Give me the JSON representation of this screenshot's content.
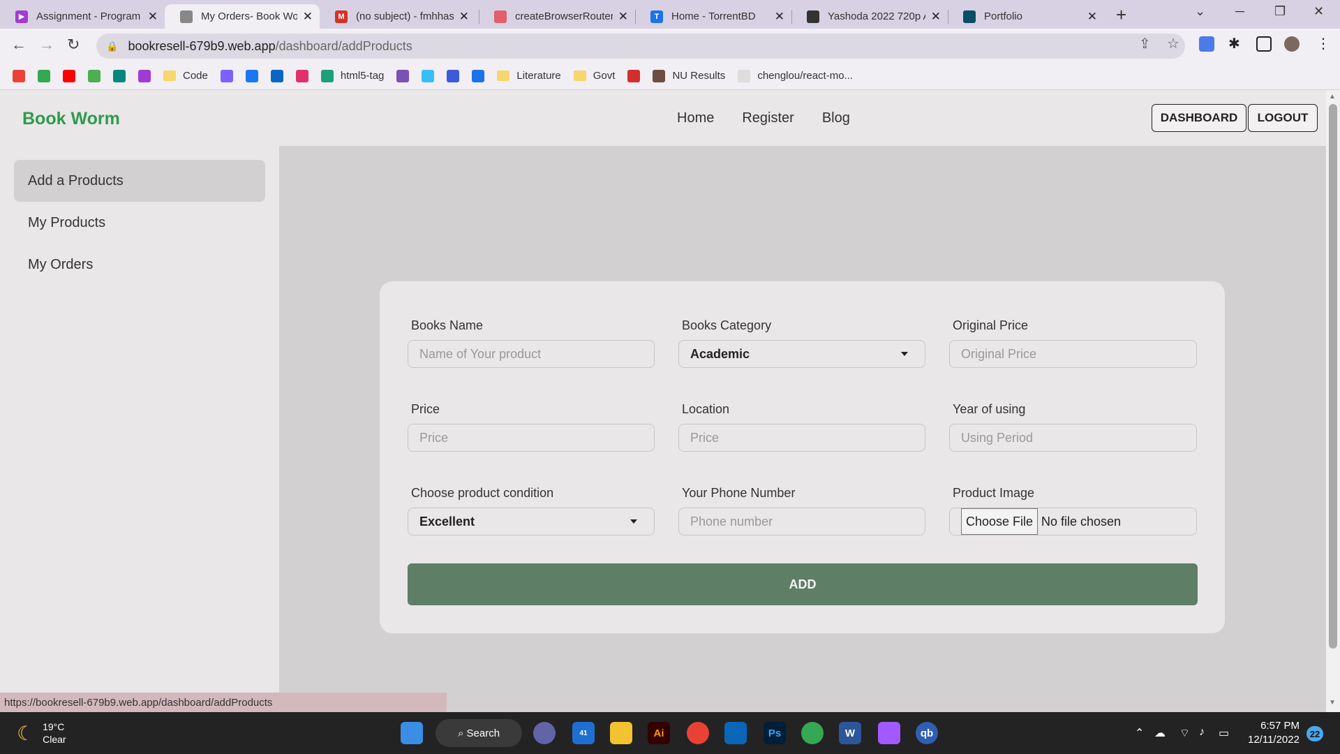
{
  "browser": {
    "tabs": [
      {
        "title": "Assignment - Program",
        "favicon_color": "#a23ad6"
      },
      {
        "title": "My Orders- Book Wor",
        "favicon_color": "#666666"
      },
      {
        "title": "(no subject) - fmhhas",
        "favicon_color": "#d93025"
      },
      {
        "title": "createBrowserRouter",
        "favicon_color": "#e35d6a"
      },
      {
        "title": "Home - TorrentBD",
        "favicon_color": "#1a73e8"
      },
      {
        "title": "Yashoda 2022 720p A",
        "favicon_color": "#333333"
      },
      {
        "title": "Portfolio",
        "favicon_color": "#0a4d68"
      }
    ],
    "url_host": "bookresell-679b9.web.app",
    "url_path": "/dashboard/addProducts",
    "bookmarks": [
      {
        "label": "",
        "color": "#ea4335"
      },
      {
        "label": "",
        "color": "#34a853"
      },
      {
        "label": "",
        "color": "#ff0000"
      },
      {
        "label": "",
        "color": "#4caf50"
      },
      {
        "label": "",
        "color": "#00897b"
      },
      {
        "label": "",
        "color": "#a23ad6"
      },
      {
        "label": "Code",
        "folder": true
      },
      {
        "label": "",
        "color": "#7b61ff"
      },
      {
        "label": "",
        "color": "#1877f2"
      },
      {
        "label": "",
        "color": "#0a66c2"
      },
      {
        "label": "",
        "color": "#e1306c"
      },
      {
        "label": "html5-tag",
        "color": "#1aa179"
      },
      {
        "label": "",
        "color": "#7952b3"
      },
      {
        "label": "",
        "color": "#38bdf8"
      },
      {
        "label": "",
        "color": "#3b5bdb"
      },
      {
        "label": "",
        "color": "#1a73e8"
      },
      {
        "label": "Literature",
        "folder": true
      },
      {
        "label": "Govt",
        "folder": true
      },
      {
        "label": "",
        "color": "#d32f2f"
      },
      {
        "label": "NU Results",
        "color": "#6d4c41"
      },
      {
        "label": "chenglou/react-mo...",
        "color": "#dddddd"
      }
    ]
  },
  "site": {
    "brand": "Book Worm",
    "nav": [
      "Home",
      "Register",
      "Blog"
    ],
    "dashboard_btn": "DASHBOARD",
    "logout_btn": "LOGOUT"
  },
  "sidebar": {
    "items": [
      "Add a Products",
      "My Products",
      "My Orders"
    ]
  },
  "form": {
    "books_name": {
      "label": "Books Name",
      "placeholder": "Name of Your product"
    },
    "books_category": {
      "label": "Books Category",
      "value": "Academic"
    },
    "original_price": {
      "label": "Original Price",
      "placeholder": "Original Price"
    },
    "price": {
      "label": "Price",
      "placeholder": "Price"
    },
    "location": {
      "label": "Location",
      "placeholder": "Price"
    },
    "year_of_using": {
      "label": "Year of using",
      "placeholder": "Using Period"
    },
    "condition": {
      "label": "Choose product condition",
      "value": "Excellent"
    },
    "phone": {
      "label": "Your Phone Number",
      "placeholder": "Phone number"
    },
    "image": {
      "label": "Product Image",
      "button": "Choose File",
      "status": "No file chosen"
    },
    "submit": "ADD"
  },
  "status_url": "https://bookresell-679b9.web.app/dashboard/addProducts",
  "taskbar": {
    "temp": "19°C",
    "condition": "Clear",
    "search": "Search",
    "time": "6:57 PM",
    "date": "12/11/2022",
    "notifications": "22",
    "mail_badge": "41"
  },
  "colors": {
    "brand": "#2e9b4f",
    "add_button": "#5e7e66"
  }
}
